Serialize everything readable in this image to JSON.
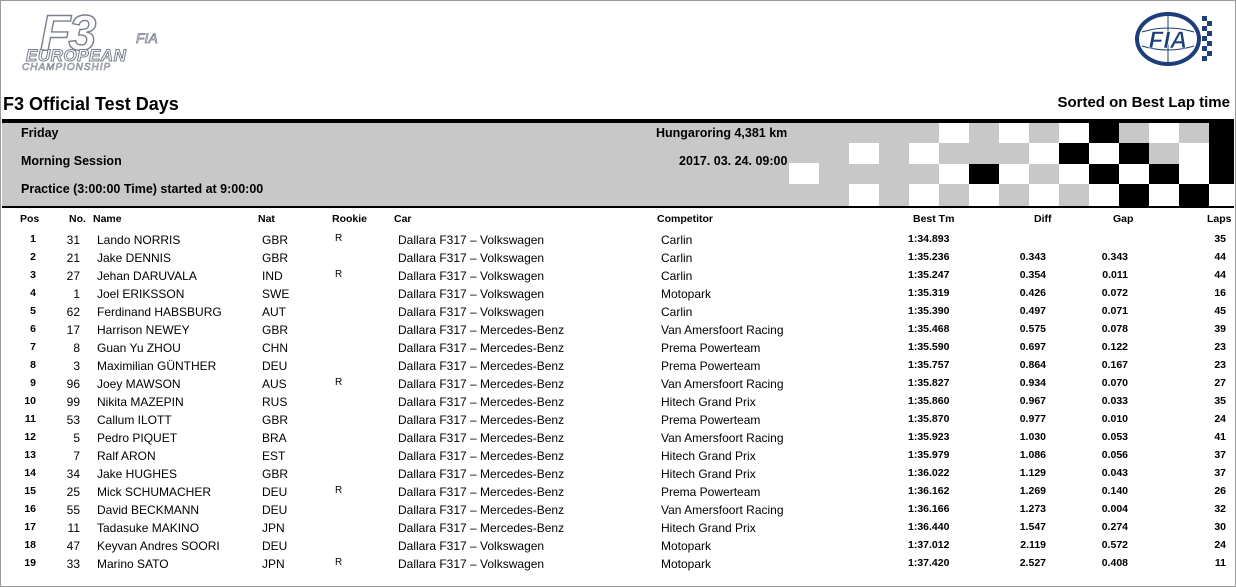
{
  "logo": {
    "f3": "F3",
    "fia_small": "FIA",
    "european": "EUROPEAN",
    "championship": "CHAMPIONSHIP",
    "fia_badge": "FIA"
  },
  "title": "F3 Official Test Days",
  "sorted_label": "Sorted on Best Lap time",
  "session": {
    "day": "Friday",
    "session_name": "Morning Session",
    "practice": "Practice (3:00:00 Time) started at 9:00:00",
    "track": "Hungaroring 4,381 km",
    "datetime": "2017. 03. 24. 09:00"
  },
  "headers": {
    "pos": "Pos",
    "no": "No.",
    "name": "Name",
    "nat": "Nat",
    "rookie": "Rookie",
    "car": "Car",
    "competitor": "Competitor",
    "best": "Best Tm",
    "diff": "Diff",
    "gap": "Gap",
    "laps": "Laps"
  },
  "rows": [
    {
      "pos": "1",
      "no": "31",
      "name": "Lando NORRIS",
      "nat": "GBR",
      "rookie": "R",
      "car": "Dallara F317 – Volkswagen",
      "competitor": "Carlin",
      "best": "1:34.893",
      "diff": "",
      "gap": "",
      "laps": "35"
    },
    {
      "pos": "2",
      "no": "21",
      "name": "Jake DENNIS",
      "nat": "GBR",
      "rookie": "",
      "car": "Dallara F317 – Volkswagen",
      "competitor": "Carlin",
      "best": "1:35.236",
      "diff": "0.343",
      "gap": "0.343",
      "laps": "44"
    },
    {
      "pos": "3",
      "no": "27",
      "name": "Jehan DARUVALA",
      "nat": "IND",
      "rookie": "R",
      "car": "Dallara F317 – Volkswagen",
      "competitor": "Carlin",
      "best": "1:35.247",
      "diff": "0.354",
      "gap": "0.011",
      "laps": "44"
    },
    {
      "pos": "4",
      "no": "1",
      "name": "Joel ERIKSSON",
      "nat": "SWE",
      "rookie": "",
      "car": "Dallara F317 – Volkswagen",
      "competitor": "Motopark",
      "best": "1:35.319",
      "diff": "0.426",
      "gap": "0.072",
      "laps": "16"
    },
    {
      "pos": "5",
      "no": "62",
      "name": "Ferdinand HABSBURG",
      "nat": "AUT",
      "rookie": "",
      "car": "Dallara F317 – Volkswagen",
      "competitor": "Carlin",
      "best": "1:35.390",
      "diff": "0.497",
      "gap": "0.071",
      "laps": "45"
    },
    {
      "pos": "6",
      "no": "17",
      "name": "Harrison NEWEY",
      "nat": "GBR",
      "rookie": "",
      "car": "Dallara F317 – Mercedes-Benz",
      "competitor": "Van Amersfoort Racing",
      "best": "1:35.468",
      "diff": "0.575",
      "gap": "0.078",
      "laps": "39"
    },
    {
      "pos": "7",
      "no": "8",
      "name": "Guan Yu ZHOU",
      "nat": "CHN",
      "rookie": "",
      "car": "Dallara F317 – Mercedes-Benz",
      "competitor": "Prema Powerteam",
      "best": "1:35.590",
      "diff": "0.697",
      "gap": "0.122",
      "laps": "23"
    },
    {
      "pos": "8",
      "no": "3",
      "name": "Maximilian GÜNTHER",
      "nat": "DEU",
      "rookie": "",
      "car": "Dallara F317 – Mercedes-Benz",
      "competitor": "Prema Powerteam",
      "best": "1:35.757",
      "diff": "0.864",
      "gap": "0.167",
      "laps": "23"
    },
    {
      "pos": "9",
      "no": "96",
      "name": "Joey MAWSON",
      "nat": "AUS",
      "rookie": "R",
      "car": "Dallara F317 – Mercedes-Benz",
      "competitor": "Van Amersfoort Racing",
      "best": "1:35.827",
      "diff": "0.934",
      "gap": "0.070",
      "laps": "27"
    },
    {
      "pos": "10",
      "no": "99",
      "name": "Nikita MAZEPIN",
      "nat": "RUS",
      "rookie": "",
      "car": "Dallara F317 – Mercedes-Benz",
      "competitor": "Hitech Grand Prix",
      "best": "1:35.860",
      "diff": "0.967",
      "gap": "0.033",
      "laps": "35"
    },
    {
      "pos": "11",
      "no": "53",
      "name": "Callum ILOTT",
      "nat": "GBR",
      "rookie": "",
      "car": "Dallara F317 – Mercedes-Benz",
      "competitor": "Prema Powerteam",
      "best": "1:35.870",
      "diff": "0.977",
      "gap": "0.010",
      "laps": "24"
    },
    {
      "pos": "12",
      "no": "5",
      "name": "Pedro PIQUET",
      "nat": "BRA",
      "rookie": "",
      "car": "Dallara F317 – Mercedes-Benz",
      "competitor": "Van Amersfoort Racing",
      "best": "1:35.923",
      "diff": "1.030",
      "gap": "0.053",
      "laps": "41"
    },
    {
      "pos": "13",
      "no": "7",
      "name": "Ralf ARON",
      "nat": "EST",
      "rookie": "",
      "car": "Dallara F317 – Mercedes-Benz",
      "competitor": "Hitech Grand Prix",
      "best": "1:35.979",
      "diff": "1.086",
      "gap": "0.056",
      "laps": "37"
    },
    {
      "pos": "14",
      "no": "34",
      "name": "Jake HUGHES",
      "nat": "GBR",
      "rookie": "",
      "car": "Dallara F317 – Mercedes-Benz",
      "competitor": "Hitech Grand Prix",
      "best": "1:36.022",
      "diff": "1.129",
      "gap": "0.043",
      "laps": "37"
    },
    {
      "pos": "15",
      "no": "25",
      "name": "Mick SCHUMACHER",
      "nat": "DEU",
      "rookie": "R",
      "car": "Dallara F317 – Mercedes-Benz",
      "competitor": "Prema Powerteam",
      "best": "1:36.162",
      "diff": "1.269",
      "gap": "0.140",
      "laps": "26"
    },
    {
      "pos": "16",
      "no": "55",
      "name": "David BECKMANN",
      "nat": "DEU",
      "rookie": "",
      "car": "Dallara F317 – Mercedes-Benz",
      "competitor": "Van Amersfoort Racing",
      "best": "1:36.166",
      "diff": "1.273",
      "gap": "0.004",
      "laps": "32"
    },
    {
      "pos": "17",
      "no": "11",
      "name": "Tadasuke MAKINO",
      "nat": "JPN",
      "rookie": "",
      "car": "Dallara F317 – Mercedes-Benz",
      "competitor": "Hitech Grand Prix",
      "best": "1:36.440",
      "diff": "1.547",
      "gap": "0.274",
      "laps": "30"
    },
    {
      "pos": "18",
      "no": "47",
      "name": "Keyvan Andres SOORI",
      "nat": "DEU",
      "rookie": "",
      "car": "Dallara F317 – Volkswagen",
      "competitor": "Motopark",
      "best": "1:37.012",
      "diff": "2.119",
      "gap": "0.572",
      "laps": "24"
    },
    {
      "pos": "19",
      "no": "33",
      "name": "Marino SATO",
      "nat": "JPN",
      "rookie": "R",
      "car": "Dallara F317 – Volkswagen",
      "competitor": "Motopark",
      "best": "1:37.420",
      "diff": "2.527",
      "gap": "0.408",
      "laps": "11"
    }
  ]
}
